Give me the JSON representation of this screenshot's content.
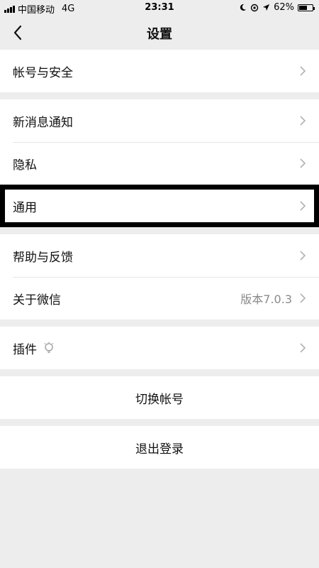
{
  "status_bar": {
    "carrier": "中国移动",
    "network": "4G",
    "time": "23:31",
    "battery_text": "62%",
    "battery_level": 0.62
  },
  "nav": {
    "title": "设置",
    "back_icon": "chevron-left-icon"
  },
  "groups": {
    "account": {
      "label": "帐号与安全"
    },
    "notifications": {
      "label": "新消息通知"
    },
    "privacy": {
      "label": "隐私"
    },
    "general": {
      "label": "通用"
    },
    "help": {
      "label": "帮助与反馈"
    },
    "about": {
      "label": "关于微信",
      "value": "版本7.0.3"
    },
    "plugins": {
      "label": "插件",
      "icon": "lightbulb-icon"
    },
    "switch_account": {
      "label": "切换帐号"
    },
    "logout": {
      "label": "退出登录"
    }
  },
  "colors": {
    "background": "#ededed",
    "row_background": "#ffffff",
    "secondary_text": "#8a8a8a",
    "highlight_border": "#000000"
  }
}
